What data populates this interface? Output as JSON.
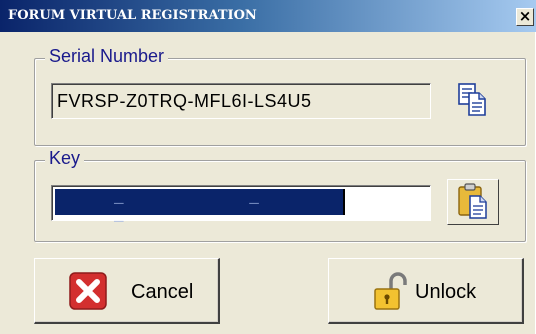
{
  "window": {
    "title": "FORUM VIRTUAL REGISTRATION",
    "close_glyph": "×"
  },
  "serial_group": {
    "legend": "Serial Number",
    "value": "FVRSP-Z0TRQ-MFL6I-LS4U5",
    "copy_icon": "copy-icon"
  },
  "key_group": {
    "legend": "Key",
    "value": "_ _ _",
    "fill_fraction": 0.78,
    "paste_icon": "paste-icon"
  },
  "buttons": {
    "cancel_label": "Cancel",
    "cancel_icon": "red-x-icon",
    "unlock_label": "Unlock",
    "unlock_icon": "padlock-open-icon"
  },
  "colors": {
    "title_start": "#0a246a",
    "title_end": "#a6caf0",
    "legend": "#1a1a8c",
    "key_fill": "#0a246a",
    "cancel_icon": "#d32f2f"
  }
}
